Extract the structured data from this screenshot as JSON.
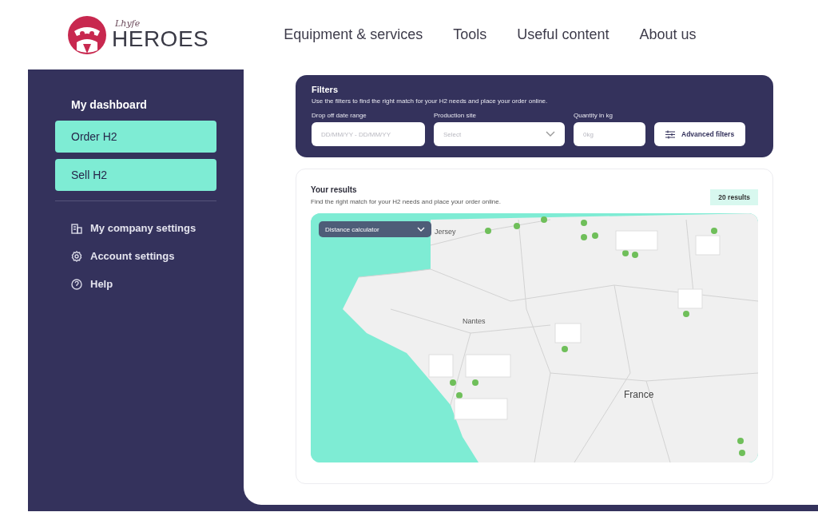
{
  "header": {
    "logo_script": "Lhyfe",
    "logo_text": "HEROES",
    "nav": [
      {
        "label": "Equipment & services"
      },
      {
        "label": "Tools"
      },
      {
        "label": "Useful content"
      },
      {
        "label": "About us"
      }
    ]
  },
  "sidebar": {
    "title": "My dashboard",
    "actions": [
      {
        "label": "Order H2"
      },
      {
        "label": "Sell H2"
      }
    ],
    "links": [
      {
        "kind": "building",
        "label": "My company settings"
      },
      {
        "kind": "gear",
        "label": "Account settings"
      },
      {
        "kind": "help",
        "label": "Help"
      }
    ]
  },
  "filters": {
    "title": "Filters",
    "description": "Use the filters to find the right match for your H2 needs and place your order online.",
    "fields": [
      {
        "kind": "text",
        "label": "Drop off date range",
        "placeholder": "DD/MM/YY - DD/MM/YY"
      },
      {
        "kind": "select",
        "label": "Production site",
        "placeholder": "Select"
      },
      {
        "kind": "text",
        "label": "Quantity in kg",
        "placeholder": "0kg"
      }
    ],
    "button": "Advanced filters"
  },
  "results": {
    "title": "Your results",
    "description": "Find the right match for your H2 needs and place your order online.",
    "count": "20 results",
    "map": {
      "dropdown": "Distance calculator",
      "places": [
        {
          "label": "Jersey"
        },
        {
          "label": "Nantes"
        },
        {
          "label": "France"
        }
      ]
    }
  }
}
